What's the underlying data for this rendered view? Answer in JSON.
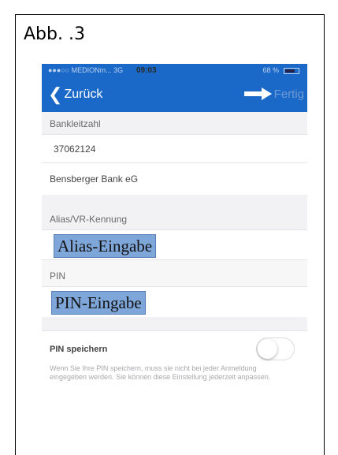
{
  "figure_label": "Abb. .3",
  "status_bar": {
    "carrier": "●●●○○ MEDIONm...  3G",
    "time": "09:03",
    "battery": "68 %"
  },
  "nav": {
    "back_label": "Zurück",
    "done_label": "Fertig",
    "accent": "#1a69c9"
  },
  "form": {
    "bankleitzahl_label": "Bankleitzahl",
    "bankleitzahl_value": "37062124",
    "bank_name": "Bensberger Bank eG",
    "alias_label": "Alias/VR-Kennung",
    "alias_annotation": "Alias-Eingabe",
    "pin_label": "PIN",
    "pin_annotation": "PIN-Eingabe",
    "save_pin_label": "PIN speichern",
    "save_pin_enabled": false,
    "save_pin_note": "Wenn Sie Ihre PIN speichern, muss sie nicht bei jeder Anmeldung eingegeben werden. Sie können diese Einstellung jederzeit anpassen."
  },
  "annotation_color": "#7fa6d9"
}
